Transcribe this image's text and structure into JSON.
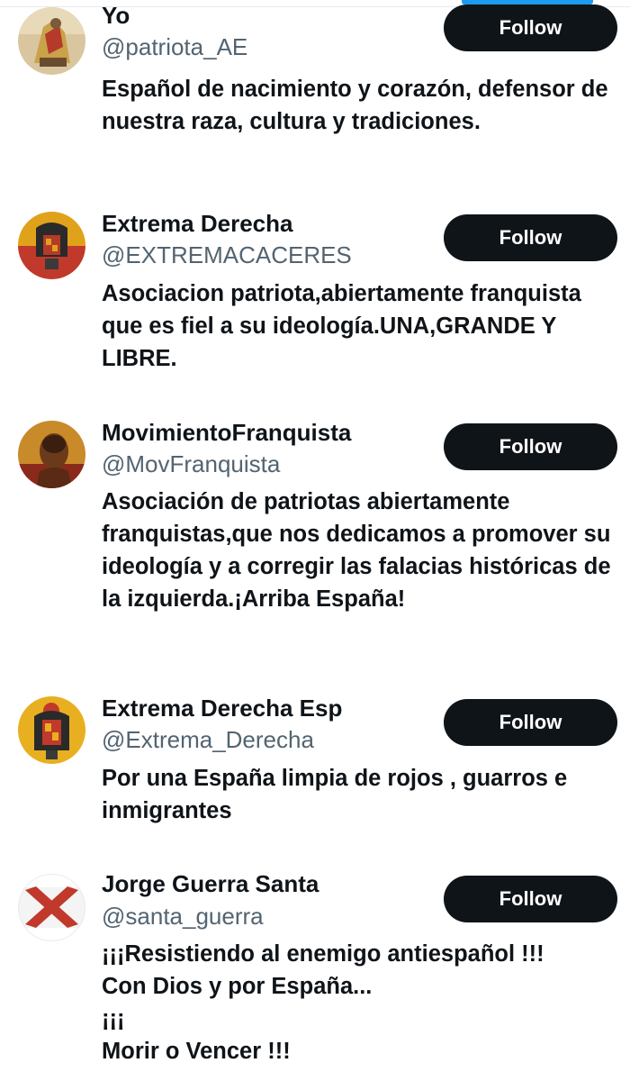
{
  "users": [
    {
      "name": "Yo",
      "handle": "@patriota_AE",
      "bio": "Español de nacimiento y corazón, defensor de nuestra raza, cultura y tradiciones.",
      "follow_label": "Follow"
    },
    {
      "name": "Extrema Derecha",
      "handle": "@EXTREMACACERES",
      "bio": "Asociacion patriota,abiertamente franquista que es fiel a su ideología.UNA,GRANDE Y LIBRE.",
      "follow_label": "Follow"
    },
    {
      "name": "MovimientoFranquista",
      "handle": "@MovFranquista",
      "bio": "Asociación de patriotas abiertamente franquistas,que nos dedicamos a promover su ideología y a corregir las falacias históricas de la izquierda.¡Arriba España!",
      "follow_label": "Follow"
    },
    {
      "name": "Extrema Derecha Esp",
      "handle": "@Extrema_Derecha",
      "bio": "Por una España limpia de rojos , guarros e inmigrantes",
      "follow_label": "Follow"
    },
    {
      "name": "Jorge Guerra Santa",
      "handle": "@santa_guerra",
      "bio": "¡¡¡Resistiendo al enemigo antiespañol !!!\nCon Dios y por España...\n¡¡¡\nMorir o Vencer !!!",
      "follow_label": "Follow"
    }
  ],
  "colors": {
    "accent": "#1d9bf0",
    "button": "#0f1419",
    "handle": "#536471"
  }
}
